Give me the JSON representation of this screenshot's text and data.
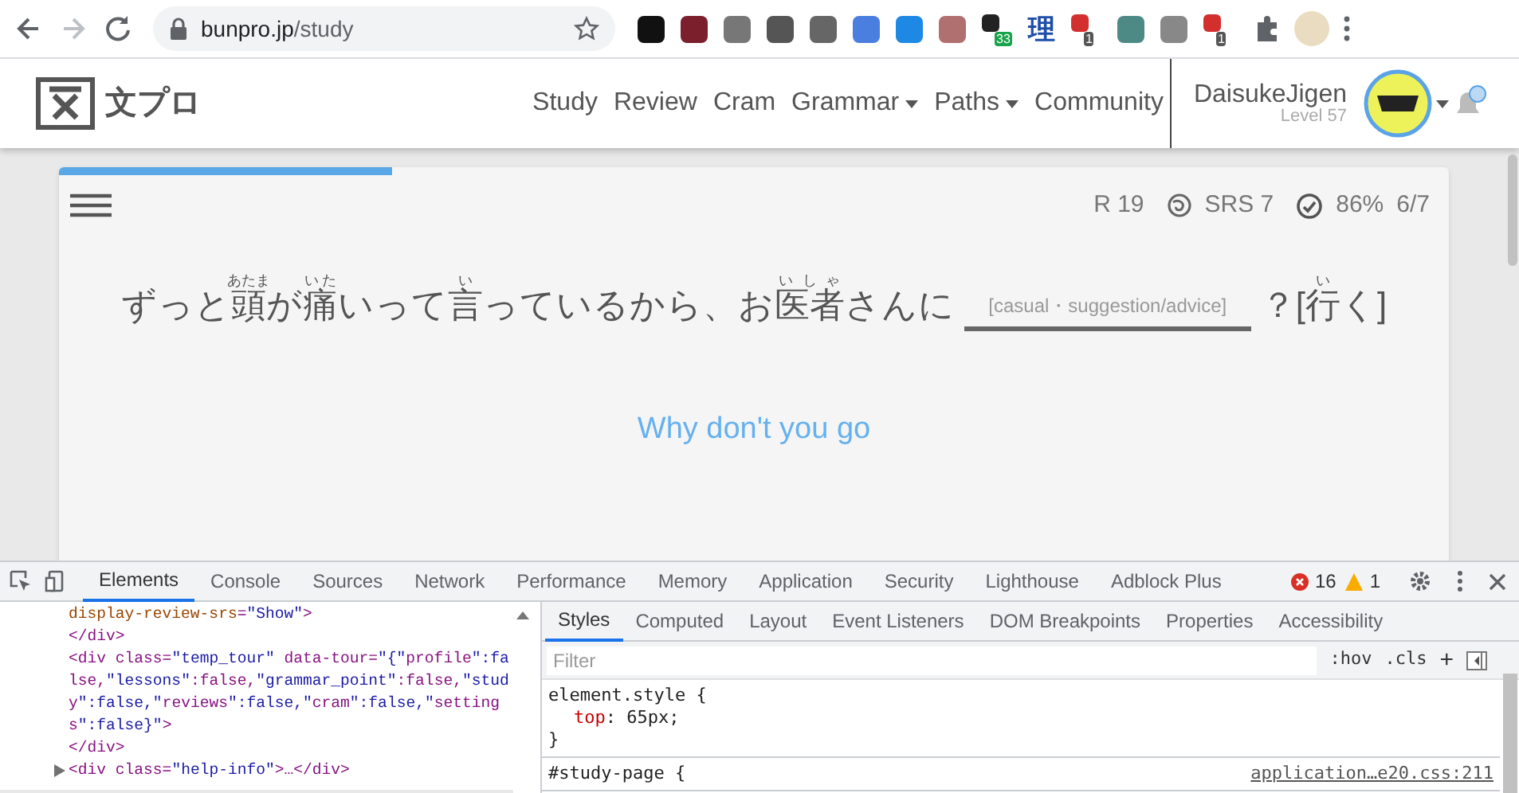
{
  "browser": {
    "url_host": "bunpro.jp",
    "url_path": "/study",
    "extensions": [
      {
        "kind": "tile"
      },
      {
        "kind": "tile"
      },
      {
        "kind": "tile"
      },
      {
        "kind": "tile"
      },
      {
        "kind": "tile"
      },
      {
        "kind": "tile"
      },
      {
        "kind": "tile"
      },
      {
        "kind": "tile"
      },
      {
        "kind": "badge",
        "badge": "33"
      },
      {
        "kind": "glyph",
        "glyph": "理"
      },
      {
        "kind": "badge",
        "badge": "1"
      },
      {
        "kind": "tile"
      },
      {
        "kind": "tile"
      },
      {
        "kind": "badge",
        "badge": "1"
      }
    ]
  },
  "site": {
    "logo_text": "文プロ",
    "nav": [
      {
        "label": "Study",
        "dropdown": false
      },
      {
        "label": "Review",
        "dropdown": false
      },
      {
        "label": "Cram",
        "dropdown": false
      },
      {
        "label": "Grammar",
        "dropdown": true
      },
      {
        "label": "Paths",
        "dropdown": true
      },
      {
        "label": "Community",
        "dropdown": false
      }
    ],
    "user": {
      "name": "DaisukeJigen",
      "level": "Level 57"
    }
  },
  "study": {
    "progress": {
      "level": 0.24
    },
    "stats": {
      "review": "R 19",
      "srs": "SRS 7",
      "accuracy": "86%",
      "count": "6/7"
    },
    "sentence": [
      {
        "text": "ずっと"
      },
      {
        "text": "頭",
        "reading": "あたま"
      },
      {
        "text": "が"
      },
      {
        "text": "痛",
        "reading": "いた"
      },
      {
        "text": "いって"
      },
      {
        "text": "言",
        "reading": "い"
      },
      {
        "text": "っているから、お"
      },
      {
        "text": "医者",
        "reading": "いしゃ"
      },
      {
        "text": "さんに"
      }
    ],
    "answer_hint": "[casual・suggestion/advice]",
    "after": [
      {
        "text": "？["
      },
      {
        "text": "行",
        "reading": "い"
      },
      {
        "text": "く]"
      }
    ],
    "translation": "Why don't you go"
  },
  "devtools": {
    "tabs": [
      {
        "label": "Elements",
        "selected": true
      },
      {
        "label": "Console",
        "selected": false
      },
      {
        "label": "Sources",
        "selected": false
      },
      {
        "label": "Network",
        "selected": false
      },
      {
        "label": "Performance",
        "selected": false
      },
      {
        "label": "Memory",
        "selected": false
      },
      {
        "label": "Application",
        "selected": false
      },
      {
        "label": "Security",
        "selected": false
      },
      {
        "label": "Lighthouse",
        "selected": false
      },
      {
        "label": "Adblock Plus",
        "selected": false
      }
    ],
    "errors": "16",
    "warnings": "1",
    "dom_lines": [
      {
        "text": "display-review-srs=\"Show\">",
        "collapsed": false
      },
      {
        "text": "</div>",
        "collapsed": false
      },
      {
        "text": "<div class=\"temp_tour\" data-tour=\"{\"profile\":fa",
        "collapsed": false
      },
      {
        "text": "lse,\"lessons\":false,\"grammar_point\":false,\"stud",
        "collapsed": false
      },
      {
        "text": "y\":false,\"reviews\":false,\"cram\":false,\"setting",
        "collapsed": false
      },
      {
        "text": "s\":false}\">",
        "collapsed": false
      },
      {
        "text": "</div>",
        "collapsed": false
      },
      {
        "text": "<div class=\"help-info\">…</div>",
        "collapsed": true
      }
    ],
    "style_tabs": [
      {
        "label": "Styles",
        "selected": true
      },
      {
        "label": "Computed",
        "selected": false
      },
      {
        "label": "Layout",
        "selected": false
      },
      {
        "label": "Event Listeners",
        "selected": false
      },
      {
        "label": "DOM Breakpoints",
        "selected": false
      },
      {
        "label": "Properties",
        "selected": false
      },
      {
        "label": "Accessibility",
        "selected": false
      }
    ],
    "filter_placeholder": "Filter",
    "hov": ":hov",
    "cls": ".cls",
    "plus": "+",
    "rules": [
      {
        "selector": "element.style {",
        "decls": [
          {
            "prop": "top",
            "value": ": 65px;"
          }
        ],
        "close": "}"
      },
      {
        "selector": "#study-page {",
        "source": "application…e20.css:211"
      }
    ]
  }
}
